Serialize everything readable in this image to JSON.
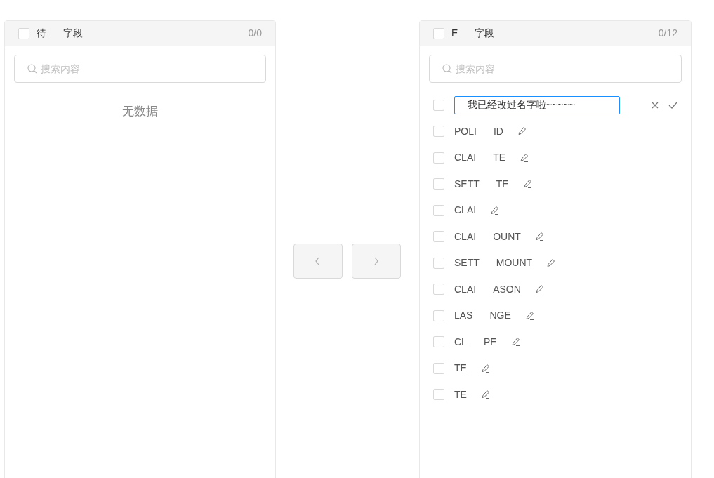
{
  "left_panel": {
    "header": {
      "checked": false,
      "title_parts": [
        "待",
        "字段"
      ],
      "count": "0/0"
    },
    "search": {
      "placeholder": "搜索内容"
    },
    "empty_text": "无数据"
  },
  "transfer_buttons": [
    {
      "kind": "back",
      "disabled": true
    },
    {
      "kind": "forward",
      "disabled": true
    }
  ],
  "right_panel": {
    "header": {
      "checked": false,
      "title_parts": [
        "E",
        "字段"
      ],
      "count": "0/12"
    },
    "search": {
      "placeholder": "搜索内容"
    },
    "items": [
      {
        "kind": "editing",
        "checked": false,
        "value": "我已经改过名字啦~~~~~"
      },
      {
        "kind": "plain",
        "checked": false,
        "label_parts": [
          "POLI",
          "ID"
        ]
      },
      {
        "kind": "plain",
        "checked": false,
        "label_parts": [
          "CLAI",
          "TE"
        ]
      },
      {
        "kind": "plain",
        "checked": false,
        "label_parts": [
          "SETT",
          "TE"
        ]
      },
      {
        "kind": "plain",
        "checked": false,
        "label_parts": [
          "CLAI"
        ]
      },
      {
        "kind": "plain",
        "checked": false,
        "label_parts": [
          "CLAI",
          "OUNT"
        ]
      },
      {
        "kind": "plain",
        "checked": false,
        "label_parts": [
          "SETT",
          "MOUNT"
        ]
      },
      {
        "kind": "plain",
        "checked": false,
        "label_parts": [
          "CLAI",
          "ASON"
        ]
      },
      {
        "kind": "plain",
        "checked": false,
        "label_parts": [
          "LAS",
          "NGE"
        ]
      },
      {
        "kind": "plain",
        "checked": false,
        "label_parts": [
          "CL",
          "PE"
        ]
      },
      {
        "kind": "plain",
        "checked": false,
        "label_parts": [
          "TE"
        ]
      },
      {
        "kind": "plain",
        "checked": false,
        "label_parts": [
          "TE"
        ]
      }
    ]
  }
}
